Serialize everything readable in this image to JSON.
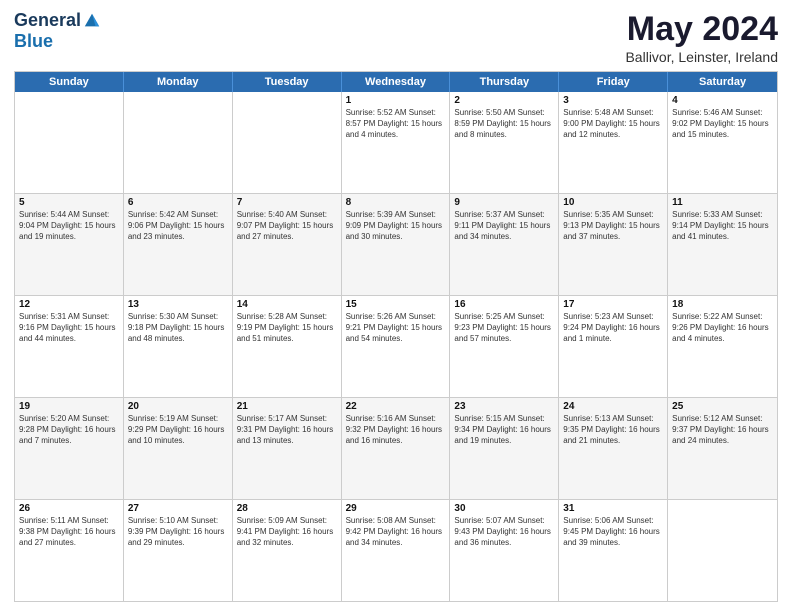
{
  "logo": {
    "general": "General",
    "blue": "Blue"
  },
  "title": "May 2024",
  "subtitle": "Ballivor, Leinster, Ireland",
  "days": [
    "Sunday",
    "Monday",
    "Tuesday",
    "Wednesday",
    "Thursday",
    "Friday",
    "Saturday"
  ],
  "rows": [
    [
      {
        "day": "",
        "content": ""
      },
      {
        "day": "",
        "content": ""
      },
      {
        "day": "",
        "content": ""
      },
      {
        "day": "1",
        "content": "Sunrise: 5:52 AM\nSunset: 8:57 PM\nDaylight: 15 hours\nand 4 minutes."
      },
      {
        "day": "2",
        "content": "Sunrise: 5:50 AM\nSunset: 8:59 PM\nDaylight: 15 hours\nand 8 minutes."
      },
      {
        "day": "3",
        "content": "Sunrise: 5:48 AM\nSunset: 9:00 PM\nDaylight: 15 hours\nand 12 minutes."
      },
      {
        "day": "4",
        "content": "Sunrise: 5:46 AM\nSunset: 9:02 PM\nDaylight: 15 hours\nand 15 minutes."
      }
    ],
    [
      {
        "day": "5",
        "content": "Sunrise: 5:44 AM\nSunset: 9:04 PM\nDaylight: 15 hours\nand 19 minutes."
      },
      {
        "day": "6",
        "content": "Sunrise: 5:42 AM\nSunset: 9:06 PM\nDaylight: 15 hours\nand 23 minutes."
      },
      {
        "day": "7",
        "content": "Sunrise: 5:40 AM\nSunset: 9:07 PM\nDaylight: 15 hours\nand 27 minutes."
      },
      {
        "day": "8",
        "content": "Sunrise: 5:39 AM\nSunset: 9:09 PM\nDaylight: 15 hours\nand 30 minutes."
      },
      {
        "day": "9",
        "content": "Sunrise: 5:37 AM\nSunset: 9:11 PM\nDaylight: 15 hours\nand 34 minutes."
      },
      {
        "day": "10",
        "content": "Sunrise: 5:35 AM\nSunset: 9:13 PM\nDaylight: 15 hours\nand 37 minutes."
      },
      {
        "day": "11",
        "content": "Sunrise: 5:33 AM\nSunset: 9:14 PM\nDaylight: 15 hours\nand 41 minutes."
      }
    ],
    [
      {
        "day": "12",
        "content": "Sunrise: 5:31 AM\nSunset: 9:16 PM\nDaylight: 15 hours\nand 44 minutes."
      },
      {
        "day": "13",
        "content": "Sunrise: 5:30 AM\nSunset: 9:18 PM\nDaylight: 15 hours\nand 48 minutes."
      },
      {
        "day": "14",
        "content": "Sunrise: 5:28 AM\nSunset: 9:19 PM\nDaylight: 15 hours\nand 51 minutes."
      },
      {
        "day": "15",
        "content": "Sunrise: 5:26 AM\nSunset: 9:21 PM\nDaylight: 15 hours\nand 54 minutes."
      },
      {
        "day": "16",
        "content": "Sunrise: 5:25 AM\nSunset: 9:23 PM\nDaylight: 15 hours\nand 57 minutes."
      },
      {
        "day": "17",
        "content": "Sunrise: 5:23 AM\nSunset: 9:24 PM\nDaylight: 16 hours\nand 1 minute."
      },
      {
        "day": "18",
        "content": "Sunrise: 5:22 AM\nSunset: 9:26 PM\nDaylight: 16 hours\nand 4 minutes."
      }
    ],
    [
      {
        "day": "19",
        "content": "Sunrise: 5:20 AM\nSunset: 9:28 PM\nDaylight: 16 hours\nand 7 minutes."
      },
      {
        "day": "20",
        "content": "Sunrise: 5:19 AM\nSunset: 9:29 PM\nDaylight: 16 hours\nand 10 minutes."
      },
      {
        "day": "21",
        "content": "Sunrise: 5:17 AM\nSunset: 9:31 PM\nDaylight: 16 hours\nand 13 minutes."
      },
      {
        "day": "22",
        "content": "Sunrise: 5:16 AM\nSunset: 9:32 PM\nDaylight: 16 hours\nand 16 minutes."
      },
      {
        "day": "23",
        "content": "Sunrise: 5:15 AM\nSunset: 9:34 PM\nDaylight: 16 hours\nand 19 minutes."
      },
      {
        "day": "24",
        "content": "Sunrise: 5:13 AM\nSunset: 9:35 PM\nDaylight: 16 hours\nand 21 minutes."
      },
      {
        "day": "25",
        "content": "Sunrise: 5:12 AM\nSunset: 9:37 PM\nDaylight: 16 hours\nand 24 minutes."
      }
    ],
    [
      {
        "day": "26",
        "content": "Sunrise: 5:11 AM\nSunset: 9:38 PM\nDaylight: 16 hours\nand 27 minutes."
      },
      {
        "day": "27",
        "content": "Sunrise: 5:10 AM\nSunset: 9:39 PM\nDaylight: 16 hours\nand 29 minutes."
      },
      {
        "day": "28",
        "content": "Sunrise: 5:09 AM\nSunset: 9:41 PM\nDaylight: 16 hours\nand 32 minutes."
      },
      {
        "day": "29",
        "content": "Sunrise: 5:08 AM\nSunset: 9:42 PM\nDaylight: 16 hours\nand 34 minutes."
      },
      {
        "day": "30",
        "content": "Sunrise: 5:07 AM\nSunset: 9:43 PM\nDaylight: 16 hours\nand 36 minutes."
      },
      {
        "day": "31",
        "content": "Sunrise: 5:06 AM\nSunset: 9:45 PM\nDaylight: 16 hours\nand 39 minutes."
      },
      {
        "day": "",
        "content": ""
      }
    ]
  ]
}
